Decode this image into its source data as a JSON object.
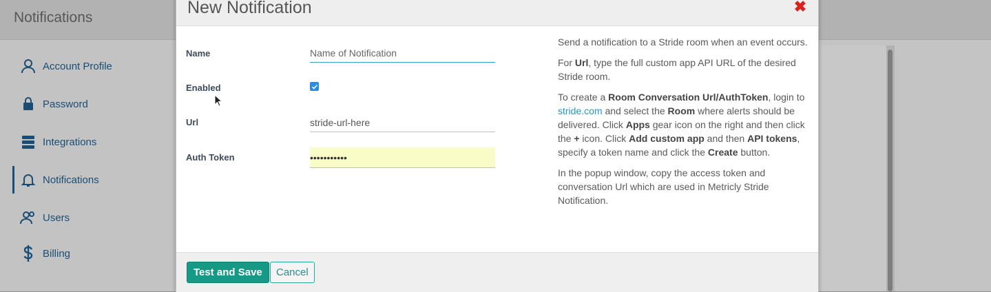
{
  "app": {
    "page_title": "Notifications",
    "sidebar": {
      "items": [
        {
          "label": "Account Profile",
          "icon": "user-icon"
        },
        {
          "label": "Password",
          "icon": "lock-icon"
        },
        {
          "label": "Integrations",
          "icon": "server-icon"
        },
        {
          "label": "Notifications",
          "icon": "bell-icon",
          "active": true
        },
        {
          "label": "Users",
          "icon": "users-icon"
        },
        {
          "label": "Billing",
          "icon": "dollar-icon"
        }
      ]
    }
  },
  "modal": {
    "title": "New Notification",
    "close_glyph": "✖",
    "fields": {
      "name": {
        "label": "Name",
        "value": "",
        "placeholder": "Name of Notification"
      },
      "enabled": {
        "label": "Enabled",
        "checked": true
      },
      "url": {
        "label": "Url",
        "value": "stride-url-here"
      },
      "auth_token": {
        "label": "Auth Token",
        "value": "•••••••••••"
      }
    },
    "help": {
      "p1": "Send a notification to a Stride room when an event occurs.",
      "p2": {
        "t1": "For ",
        "b1": "Url",
        "t2": ", type the full custom app API URL of the desired Stride room."
      },
      "p3": {
        "t1": "To create a ",
        "b1": "Room Conversation Url/AuthToken",
        "t2": ", login to ",
        "link": "stride.com",
        "t3": " and select the ",
        "b2": "Room",
        "t4": " where alerts should be delivered. Click ",
        "b3": "Apps",
        "t5": " gear icon on the right and then click the ",
        "b4": "+",
        "t6": " icon. Click ",
        "b5": "Add custom app",
        "t7": " and then ",
        "b6": "API tokens",
        "t8": ", specify a token name and click the ",
        "b7": "Create",
        "t9": " button."
      },
      "p4": "In the popup window, copy the access token and conversation Url which are used in Metricly Stride Notification."
    },
    "footer": {
      "primary_label": "Test and Save",
      "secondary_label": "Cancel"
    }
  },
  "colors": {
    "accent": "#179a85",
    "link": "#1f9bc9",
    "close": "#d9211d",
    "nav": "#1f5f8f"
  }
}
